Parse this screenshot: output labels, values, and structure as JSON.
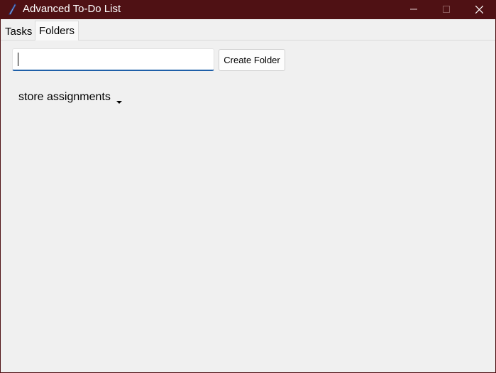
{
  "window": {
    "title": "Advanced To-Do List",
    "app_icon": "feather-pen-icon",
    "controls": [
      "minimize-icon",
      "maximize-icon",
      "close-icon"
    ],
    "titlebar_color": "#4f1114"
  },
  "tabs": [
    {
      "label": "Tasks",
      "selected": false
    },
    {
      "label": "Folders",
      "selected": true
    }
  ],
  "folders_panel": {
    "new_folder_input": {
      "value": "",
      "placeholder": ""
    },
    "create_button_label": "Create Folder",
    "folder_select": {
      "selected": "store assignments",
      "icon": "dropdown-arrow-icon"
    }
  },
  "colors": {
    "input_focus_border": "#1e5fa8",
    "background": "#f0f0f0"
  }
}
